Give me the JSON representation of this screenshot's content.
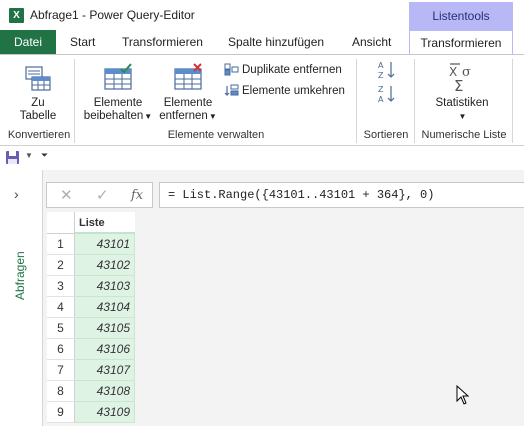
{
  "window": {
    "title": "Abfrage1 - Power Query-Editor",
    "context_group": "Listentools"
  },
  "tabs": {
    "file": "Datei",
    "start": "Start",
    "transform1": "Transformieren",
    "add_column": "Spalte hinzufügen",
    "view": "Ansicht",
    "transform_active": "Transformieren"
  },
  "ribbon": {
    "to_table_line1": "Zu",
    "to_table_line2": "Tabelle",
    "keep_items_line1": "Elemente",
    "keep_items_line2": "beibehalten",
    "remove_items_line1": "Elemente",
    "remove_items_line2": "entfernen",
    "remove_duplicates": "Duplikate entfernen",
    "reverse_items": "Elemente umkehren",
    "statistics": "Statistiken",
    "groups": {
      "convert": "Konvertieren",
      "manage_items": "Elemente verwalten",
      "sort": "Sortieren",
      "numeric_list": "Numerische Liste"
    }
  },
  "queries_pane": {
    "label": "Abfragen"
  },
  "formula_bar": {
    "formula": "= List.Range({43101..43101 + 364}, 0)"
  },
  "grid": {
    "column_header": "Liste",
    "rows": [
      {
        "num": "1",
        "value": "43101"
      },
      {
        "num": "2",
        "value": "43102"
      },
      {
        "num": "3",
        "value": "43103"
      },
      {
        "num": "4",
        "value": "43104"
      },
      {
        "num": "5",
        "value": "43105"
      },
      {
        "num": "6",
        "value": "43106"
      },
      {
        "num": "7",
        "value": "43107"
      },
      {
        "num": "8",
        "value": "43108"
      },
      {
        "num": "9",
        "value": "43109"
      }
    ]
  },
  "colors": {
    "excel_green": "#217346",
    "context_tab": "#b7b8f5",
    "cell_fill": "#dff3e5"
  }
}
